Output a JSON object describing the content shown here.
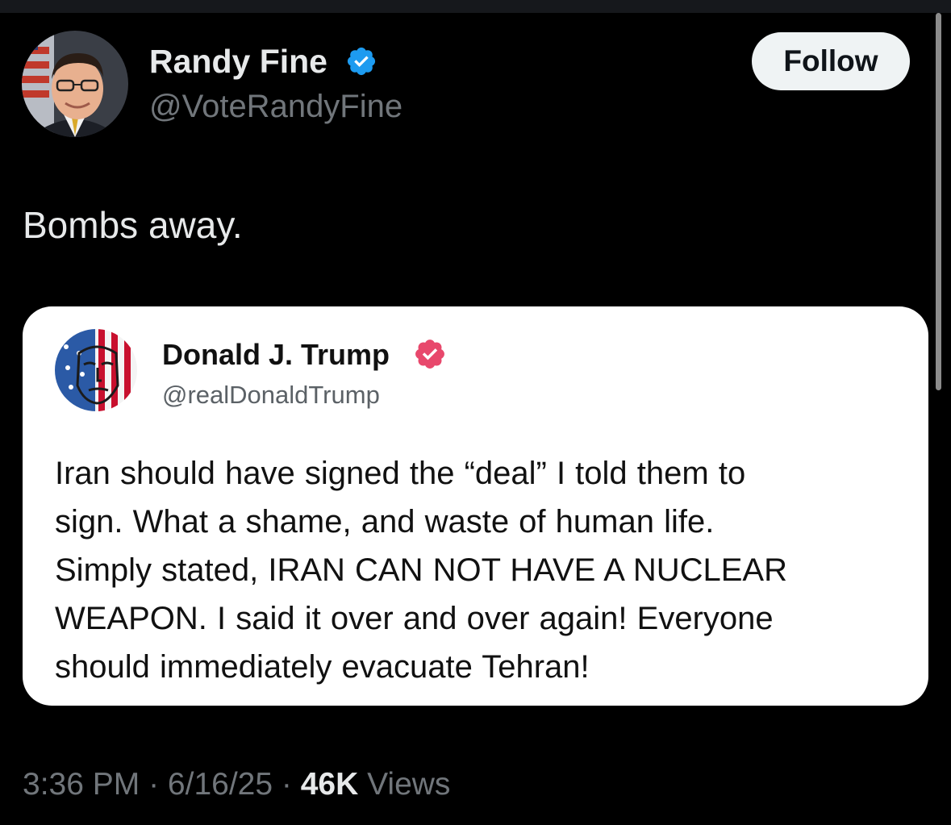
{
  "author": {
    "name": "Randy Fine",
    "handle": "@VoteRandyFine",
    "verified_color": "#1d9bf0"
  },
  "follow_button": {
    "label": "Follow"
  },
  "tweet": {
    "text": "Bombs away."
  },
  "quote": {
    "name": "Donald J. Trump",
    "handle": "@realDonaldTrump",
    "verified_color": "#e8486c",
    "body": "Iran should have signed the “deal” I told them to\nsign. What a shame, and waste of human life.\nSimply stated, IRAN CAN NOT HAVE A NUCLEAR\nWEAPON. I said it over and over again! Everyone\nshould immediately evacuate Tehran!"
  },
  "meta": {
    "time": "3:36 PM",
    "separator": " · ",
    "date": "6/16/25",
    "views_count": "46K",
    "views_label": " Views"
  },
  "icons": {
    "author_badge": "verified-badge-icon",
    "quote_badge": "verified-badge-icon"
  }
}
